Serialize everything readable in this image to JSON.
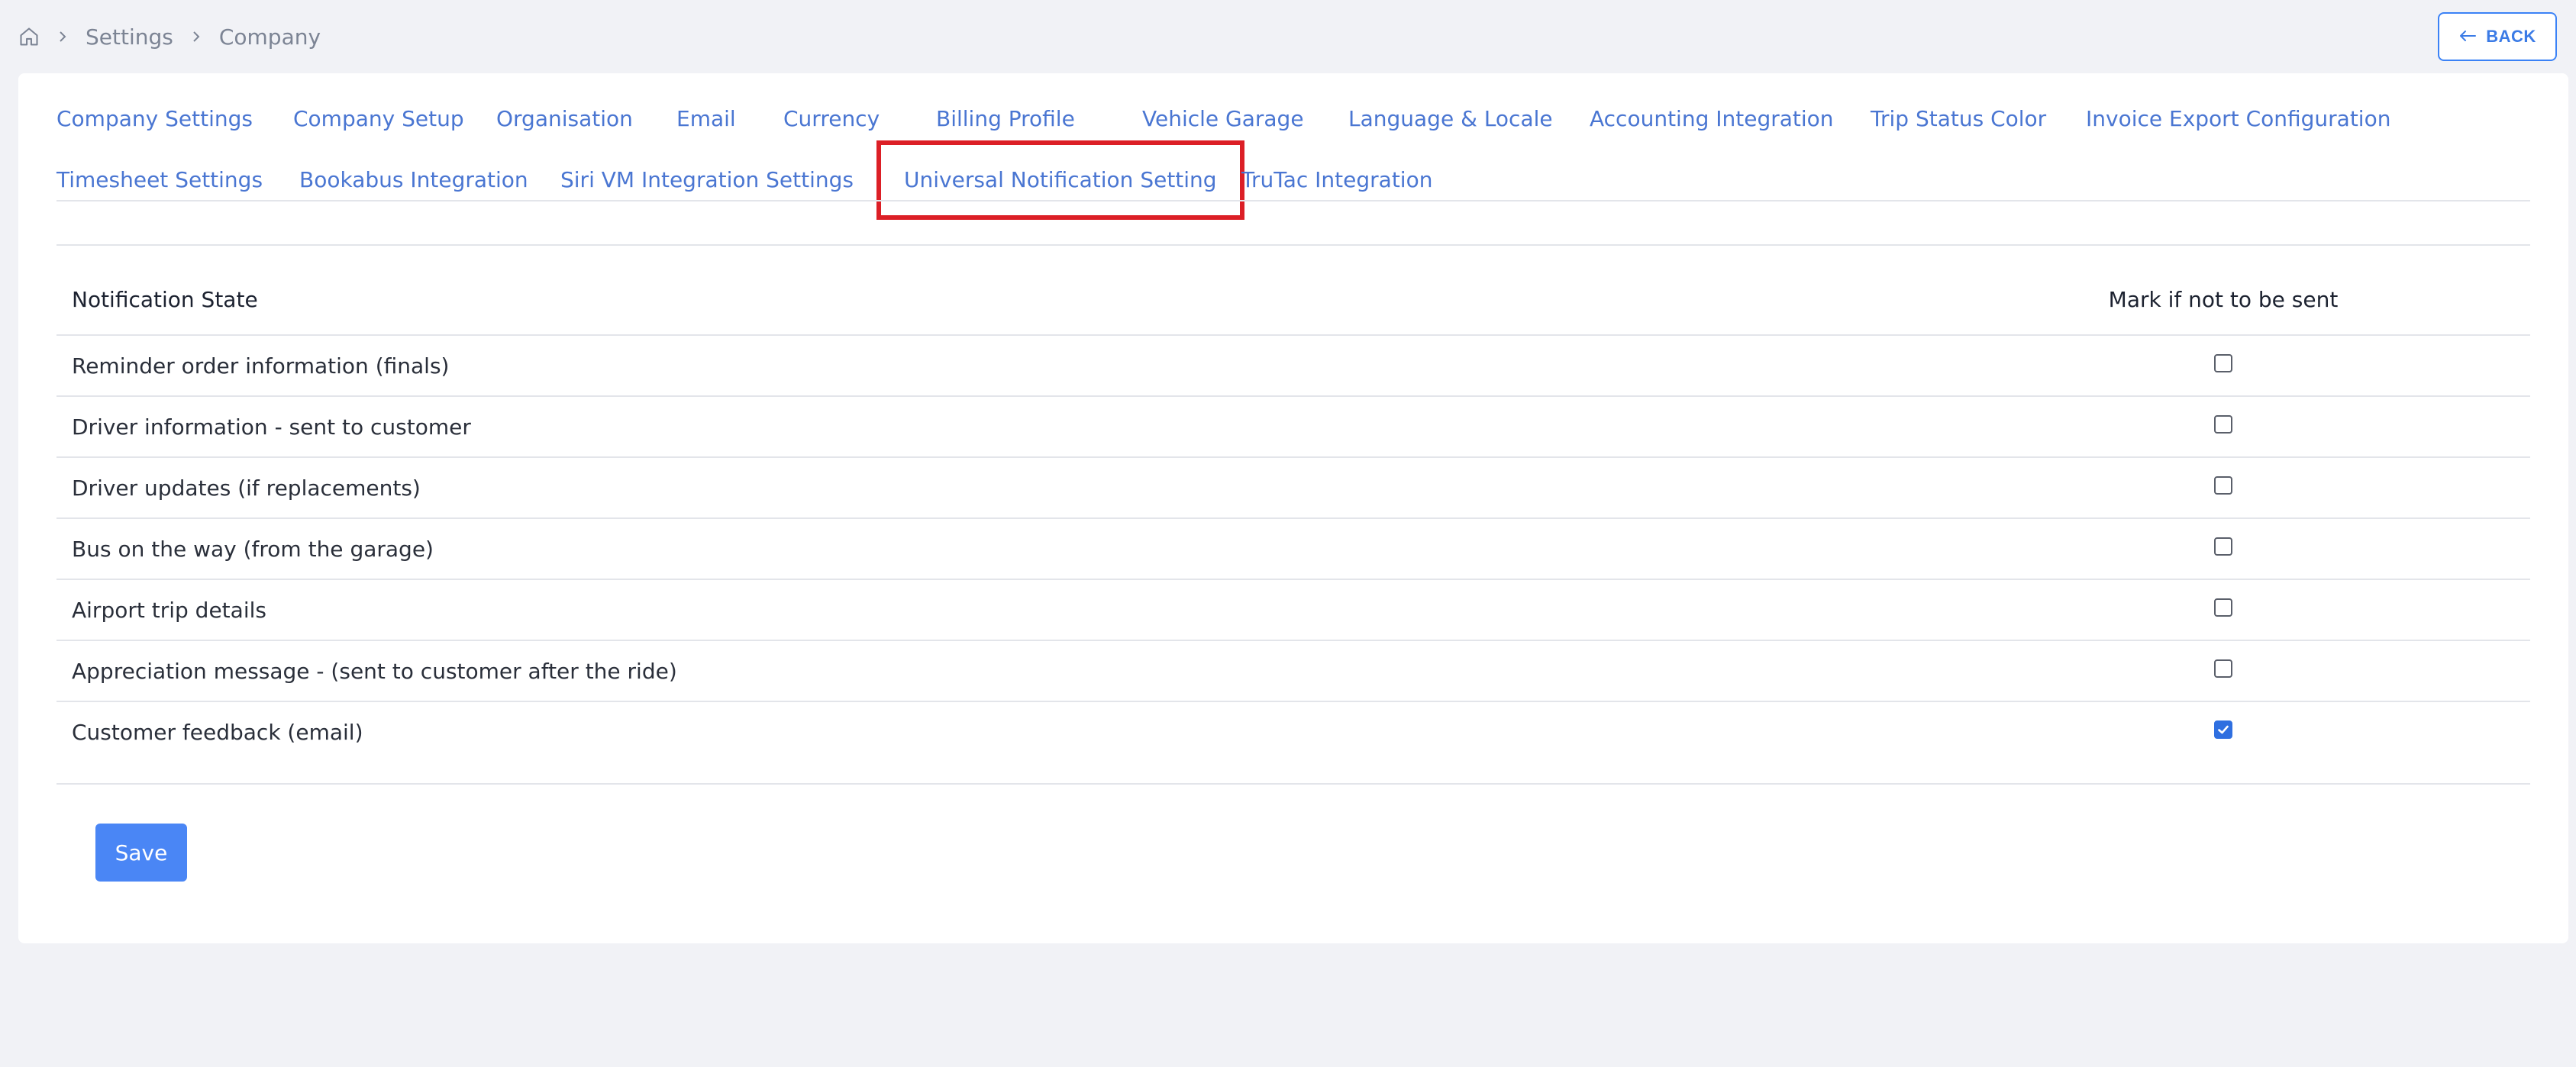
{
  "breadcrumb": {
    "home_icon": "home-icon",
    "items": [
      "Settings",
      "Company"
    ]
  },
  "back_button": {
    "label": "BACK",
    "icon": "arrow-left-icon"
  },
  "tabs": {
    "row1": [
      {
        "label": "Company Settings"
      },
      {
        "label": "Company Setup"
      },
      {
        "label": "Organisation"
      },
      {
        "label": "Email"
      },
      {
        "label": "Currency"
      },
      {
        "label": "Billing Profile"
      },
      {
        "label": "Vehicle Garage"
      },
      {
        "label": "Language & Locale"
      },
      {
        "label": "Accounting Integration"
      },
      {
        "label": "Trip Status Color"
      },
      {
        "label": "Invoice Export Configuration"
      }
    ],
    "row2": [
      {
        "label": "Timesheet Settings"
      },
      {
        "label": "Bookabus Integration"
      },
      {
        "label": "Siri VM Integration Settings"
      },
      {
        "label": "Universal Notification Setting"
      },
      {
        "label": "TruTac Integration"
      }
    ],
    "active": "Universal Notification Setting",
    "highlight_color": "#dc1f26"
  },
  "table": {
    "headers": {
      "state": "Notification State",
      "mark": "Mark if not to be sent"
    },
    "rows": [
      {
        "label": "Reminder order information (finals)",
        "checked": false
      },
      {
        "label": "Driver information - sent to customer",
        "checked": false
      },
      {
        "label": "Driver updates (if replacements)",
        "checked": false
      },
      {
        "label": "Bus on the way (from the garage)",
        "checked": false
      },
      {
        "label": "Airport trip details",
        "checked": false
      },
      {
        "label": "Appreciation message - (sent to customer after the ride)",
        "checked": false
      },
      {
        "label": "Customer feedback (email)",
        "checked": true
      }
    ]
  },
  "save_button": {
    "label": "Save"
  },
  "colors": {
    "accent": "#4a86f5",
    "tab_text": "#4a76d2",
    "background": "#f1f2f6"
  }
}
